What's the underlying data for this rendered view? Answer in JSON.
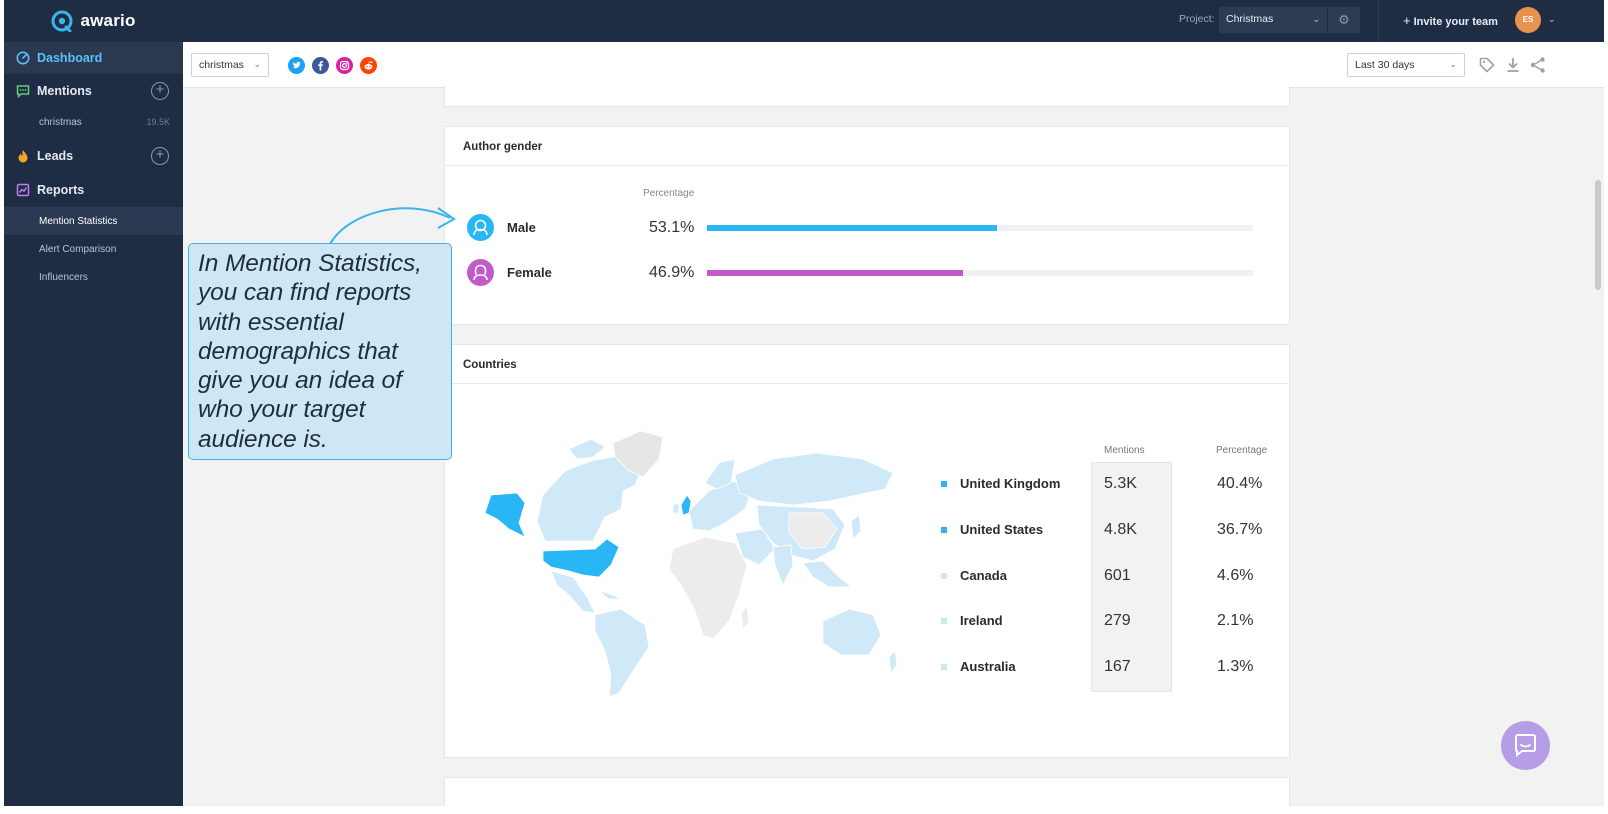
{
  "brand": {
    "name": "awario",
    "accent": "#3ab4ea"
  },
  "sidebar": {
    "dashboard": "Dashboard",
    "mentions": "Mentions",
    "mention_alerts": [
      {
        "label": "christmas",
        "count": "19.5K"
      }
    ],
    "leads": "Leads",
    "reports": "Reports",
    "report_items": [
      {
        "label": "Mention Statistics",
        "active": true
      },
      {
        "label": "Alert Comparison",
        "active": false
      },
      {
        "label": "Influencers",
        "active": false
      }
    ]
  },
  "topbar": {
    "project_label": "Project:",
    "project_value": "Christmas",
    "invite_label": "Invite your team",
    "avatar_initials": "ES"
  },
  "filters": {
    "alert_value": "christmas",
    "date_value": "Last 30 days",
    "sources": [
      "twitter-icon",
      "facebook-icon",
      "instagram-icon",
      "reddit-icon"
    ]
  },
  "gender": {
    "title": "Author gender",
    "percentage_header": "Percentage",
    "rows": [
      {
        "label": "Male",
        "value": "53.1%",
        "fraction": 0.531,
        "color": "#29b6f6"
      },
      {
        "label": "Female",
        "value": "46.9%",
        "fraction": 0.469,
        "color": "#c25bc9"
      }
    ]
  },
  "countries": {
    "title": "Countries",
    "mentions_header": "Mentions",
    "percentage_header": "Percentage",
    "rows": [
      {
        "name": "United Kingdom",
        "mentions": "5.3K",
        "percentage": "40.4%",
        "color": "#29b6f6"
      },
      {
        "name": "United States",
        "mentions": "4.8K",
        "percentage": "36.7%",
        "color": "#29b6f6"
      },
      {
        "name": "Canada",
        "mentions": "601",
        "percentage": "4.6%",
        "color": "#c9e8f8"
      },
      {
        "name": "Ireland",
        "mentions": "279",
        "percentage": "2.1%",
        "color": "#c9e8f8"
      },
      {
        "name": "Australia",
        "mentions": "167",
        "percentage": "1.3%",
        "color": "#c9e8f8"
      }
    ]
  },
  "callout": {
    "lines": [
      "In Mention Statistics,",
      "you can find reports",
      "with essential",
      "demographics that",
      "give you an idea of",
      "who your target",
      "audience is."
    ]
  }
}
